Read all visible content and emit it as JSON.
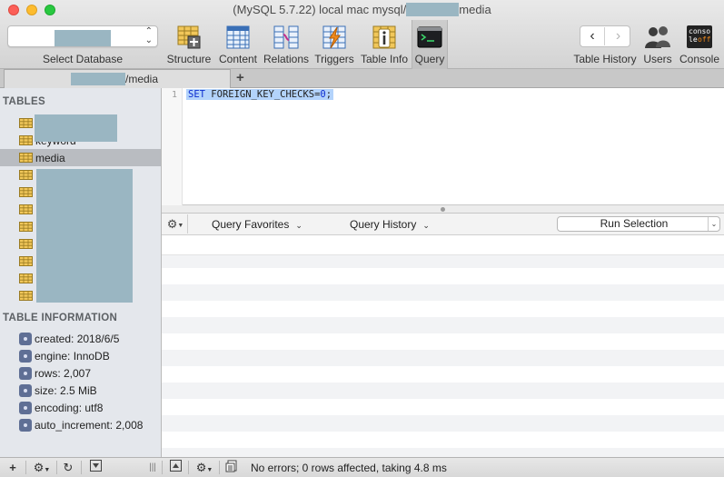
{
  "window": {
    "title_prefix": "(MySQL 5.7.22) local mac mysql/",
    "title_suffix": "media"
  },
  "toolbar": {
    "select_database_label": "Select Database",
    "items": [
      {
        "label": "Structure",
        "icon": "structure-icon"
      },
      {
        "label": "Content",
        "icon": "content-icon"
      },
      {
        "label": "Relations",
        "icon": "relations-icon"
      },
      {
        "label": "Triggers",
        "icon": "triggers-icon"
      },
      {
        "label": "Table Info",
        "icon": "table-info-icon"
      },
      {
        "label": "Query",
        "icon": "query-icon",
        "active": true
      }
    ],
    "table_history_label": "Table History",
    "users_label": "Users",
    "console_label": "Console",
    "console_icon_text": [
      "conso",
      "le",
      "off"
    ]
  },
  "tab": {
    "label": "/media",
    "add_symbol": "+"
  },
  "sidebar": {
    "tables_title": "TABLES",
    "tables": [
      {
        "name": "",
        "redacted": true
      },
      {
        "name": "keyword",
        "partially_hidden": true
      },
      {
        "name": "media",
        "selected": true
      },
      {
        "name": "",
        "redacted": true
      },
      {
        "name": "",
        "redacted": true
      },
      {
        "name": "",
        "redacted": true
      },
      {
        "name": "",
        "redacted": true
      },
      {
        "name": "",
        "redacted": true
      },
      {
        "name": "",
        "redacted": true
      },
      {
        "name": "",
        "redacted": true
      },
      {
        "name": "",
        "redacted": true
      }
    ],
    "info_title": "TABLE INFORMATION",
    "info": [
      "created: 2018/6/5",
      "engine: InnoDB",
      "rows: 2,007",
      "size: 2.5 MiB",
      "encoding: utf8",
      "auto_increment: 2,008"
    ]
  },
  "editor": {
    "line_number": "1",
    "sql_keyword": "SET",
    "sql_identifier": "FOREIGN_KEY_CHECKS",
    "sql_operator": "=",
    "sql_value": "0",
    "sql_terminator": ";"
  },
  "query_bar": {
    "favorites_label": "Query Favorites",
    "history_label": "Query History",
    "run_label": "Run Selection"
  },
  "status": {
    "message": "No errors; 0 rows affected, taking 4.8 ms"
  },
  "colors": {
    "selection": "#b3d3fb",
    "sql_keyword": "#0b2ccf",
    "redaction": "#9ab6c2",
    "sidebar_bg": "#e4e7ec"
  }
}
